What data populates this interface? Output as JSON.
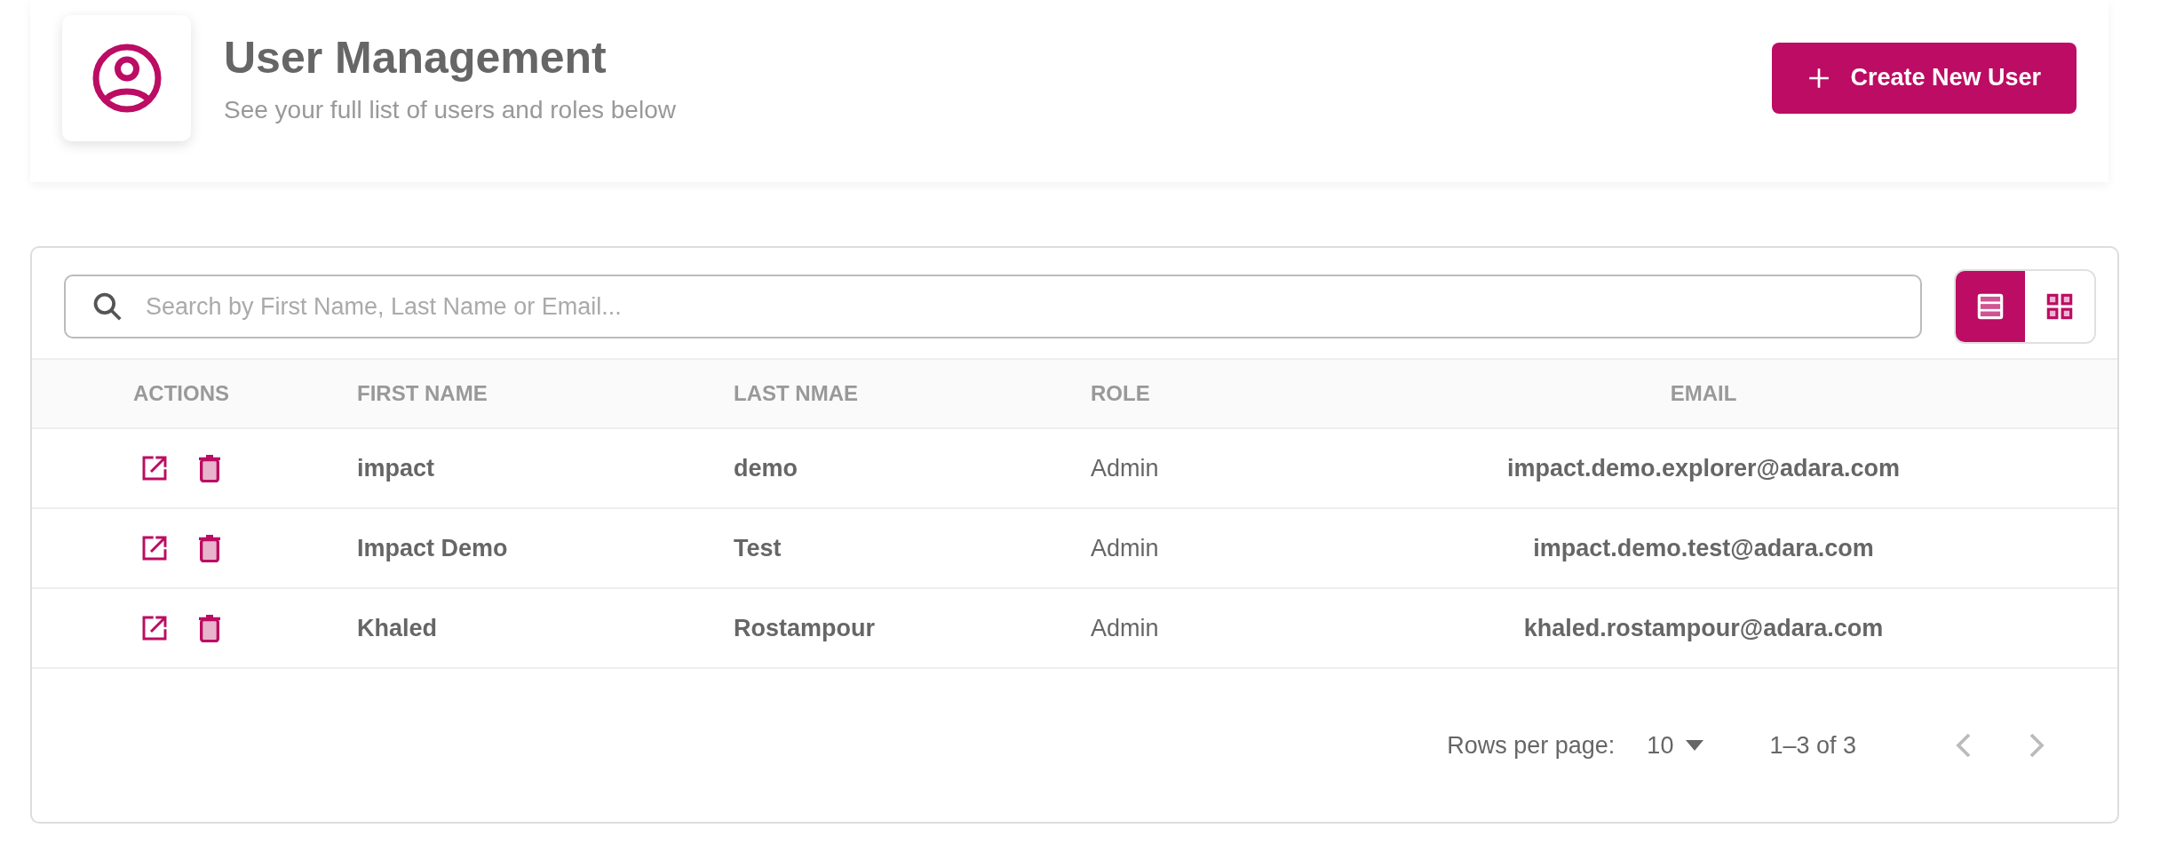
{
  "header": {
    "title": "User Management",
    "subtitle": "See your full list of users and roles below",
    "create_button": "Create New User"
  },
  "search": {
    "placeholder": "Search by First Name, Last Name or Email..."
  },
  "view_toggle": [
    {
      "kind": "list",
      "selected": true
    },
    {
      "kind": "grid",
      "selected": false
    }
  ],
  "table": {
    "columns": [
      "ACTIONS",
      "FIRST NAME",
      "LAST NMAE",
      "ROLE",
      "EMAIL"
    ],
    "rows": [
      {
        "first_name": "impact",
        "last_name": "demo",
        "role": "Admin",
        "email": "impact.demo.explorer@adara.com"
      },
      {
        "first_name": "Impact Demo",
        "last_name": "Test",
        "role": "Admin",
        "email": "impact.demo.test@adara.com"
      },
      {
        "first_name": "Khaled",
        "last_name": "Rostampour",
        "role": "Admin",
        "email": "khaled.rostampour@adara.com"
      }
    ]
  },
  "pagination": {
    "rows_per_page_label": "Rows per page:",
    "rows_per_page": "10",
    "range": "1–3 of 3",
    "previous_disabled": true,
    "next_disabled": true
  }
}
